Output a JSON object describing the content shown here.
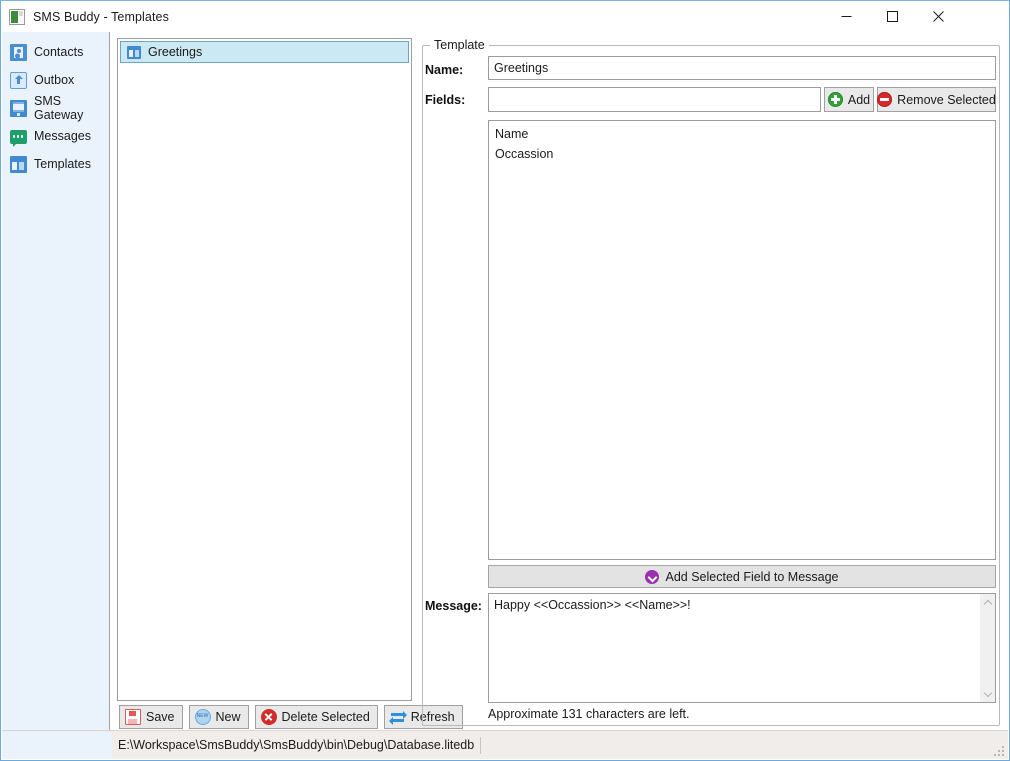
{
  "window": {
    "title": "SMS Buddy - Templates",
    "title_icon": "app-icon",
    "minimize_label": "─",
    "maximize_label": "□",
    "close_label": "✕"
  },
  "sidebar": {
    "items": [
      {
        "label": "Contacts",
        "icon": "contacts-icon"
      },
      {
        "label": "Outbox",
        "icon": "outbox-icon"
      },
      {
        "label": "SMS Gateway",
        "icon": "gateway-icon"
      },
      {
        "label": "Messages",
        "icon": "messages-icon"
      },
      {
        "label": "Templates",
        "icon": "templates-icon"
      }
    ]
  },
  "template_list": {
    "items": [
      {
        "label": "Greetings",
        "icon": "templates-icon",
        "selected": true
      }
    ]
  },
  "list_toolbar": {
    "buttons": [
      {
        "label": "Save",
        "icon": "floppy-disk-icon"
      },
      {
        "label": "New",
        "icon": "new-burst-icon"
      },
      {
        "label": "Delete Selected",
        "icon": "delete-circle-icon"
      },
      {
        "label": "Refresh",
        "icon": "refresh-arrows-icon"
      }
    ]
  },
  "template_panel": {
    "legend": "Template",
    "name_label": "Name:",
    "name_value": "Greetings",
    "name_placeholder": "",
    "fields_label": "Fields:",
    "fields_value": "",
    "fields_placeholder": "",
    "add_button": "Add",
    "add_button_icon": "green-plus-icon",
    "remove_button": "Remove Selected",
    "remove_button_icon": "red-minus-icon",
    "fields": [
      "Name",
      "Occassion"
    ],
    "add_field_button": "Add Selected Field to Message",
    "add_field_button_icon": "purple-chevron-down-icon",
    "message_label": "Message:",
    "message_value": "Happy <<Occassion>> <<Name>>!",
    "char_count": "Approximate 131 characters are left."
  },
  "statusbar": {
    "path": "E:\\Workspace\\SmsBuddy\\SmsBuddy\\bin\\Debug\\Database.litedb"
  },
  "colors": {
    "sidebar_bg": "#eaf3fc",
    "selection_bg": "#cce8f2",
    "selection_border": "#6aa7c4",
    "accent_blue": "#3f8ad0",
    "green": "#33a13b",
    "red": "#d42a2a",
    "purple": "#9b2fae",
    "window_border": "#6fa8dc",
    "status_bg": "#f0edeb"
  }
}
